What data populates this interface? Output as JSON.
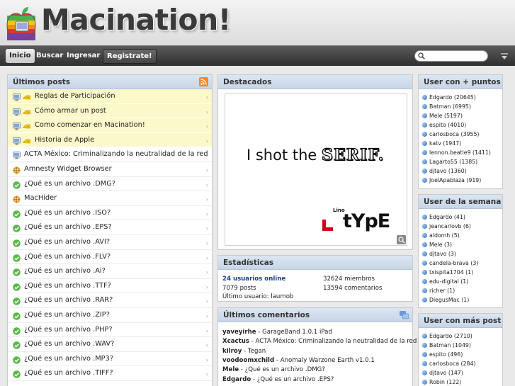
{
  "site": {
    "title": "Macination!"
  },
  "nav": {
    "inicio": "Inicio",
    "buscar": "Buscar",
    "ingresar": "Ingresar",
    "registrate": "Registrate!",
    "search_placeholder": ""
  },
  "posts": {
    "title": "Últimos posts",
    "items": [
      {
        "label": "Reglas de Participación",
        "sticky": true,
        "icon": "mac-icon"
      },
      {
        "label": "Cómo armar un post",
        "sticky": true,
        "icon": "mac-icon"
      },
      {
        "label": "Como comenzar en Macination!",
        "sticky": true,
        "icon": "mac-icon"
      },
      {
        "label": "Historia de Apple",
        "sticky": true,
        "icon": "mac-icon"
      },
      {
        "label": "ACTA México: Criminalizando la neutralidad de la red",
        "sticky": false,
        "icon": "mac-icon"
      },
      {
        "label": "Amnesty Widget Browser",
        "sticky": false,
        "icon": "widget-icon"
      },
      {
        "label": "¿Qué es un archivo .DMG?",
        "sticky": false,
        "icon": "check-icon"
      },
      {
        "label": "MacHider",
        "sticky": false,
        "icon": "widget-icon"
      },
      {
        "label": "¿Qué es un archivo .ISO?",
        "sticky": false,
        "icon": "check-icon"
      },
      {
        "label": "¿Qué es un archivo .EPS?",
        "sticky": false,
        "icon": "check-icon"
      },
      {
        "label": "¿Qué es un archivo .AVI?",
        "sticky": false,
        "icon": "check-icon"
      },
      {
        "label": "¿Qué es un archivo .FLV?",
        "sticky": false,
        "icon": "check-icon"
      },
      {
        "label": "¿Qué es un archivo .Ai?",
        "sticky": false,
        "icon": "check-icon"
      },
      {
        "label": "¿Qué es un archivo .TTF?",
        "sticky": false,
        "icon": "check-icon"
      },
      {
        "label": "¿Qué es un archivo .RAR?",
        "sticky": false,
        "icon": "check-icon"
      },
      {
        "label": "¿Qué es un archivo .ZIP?",
        "sticky": false,
        "icon": "check-icon"
      },
      {
        "label": "¿Qué es un archivo .PHP?",
        "sticky": false,
        "icon": "check-icon"
      },
      {
        "label": "¿Qué es un archivo .WAV?",
        "sticky": false,
        "icon": "check-icon"
      },
      {
        "label": "¿Qué es un archivo .MP3?",
        "sticky": false,
        "icon": "check-icon"
      },
      {
        "label": "¿Qué es un archivo .TIFF?",
        "sticky": false,
        "icon": "check-icon"
      }
    ]
  },
  "destacados": {
    "title": "Destacados",
    "headline_prefix": "I shot the ",
    "headline_emph": "SERIF.",
    "brand_small": "Lino",
    "brand_large": "tYpE"
  },
  "stats": {
    "title": "Estadísticas",
    "online": "24 usuarios online",
    "members": "32624 miembros",
    "posts": "7079 posts",
    "comments": "13594 comentarios",
    "last_user": "Último usuario: laumob"
  },
  "comments": {
    "title": "Últimos comentarios",
    "items": [
      {
        "user": "yaveyirhe",
        "text": " - GarageBand 1.0.1 iPad"
      },
      {
        "user": "Xcactus",
        "text": " - ACTA México: Criminalizando la neutralidad de la red"
      },
      {
        "user": "kilroy",
        "text": " - Tegan"
      },
      {
        "user": "voodoomxchild",
        "text": " - Anomaly Warzone Earth v1.0.1"
      },
      {
        "user": "Mele",
        "text": " - ¿Qué es un archivo .DMG?"
      },
      {
        "user": "Edgardo",
        "text": " - ¿Qué es un archivo .EPS?"
      }
    ]
  },
  "top_users": {
    "title": "User con + puntos",
    "items": [
      "Edgardo (20645)",
      "Batman (6995)",
      "Mele (5197)",
      "espito (4010)",
      "carlosboca (3955)",
      "katv (1947)",
      "lennon.beatle9 (1411)",
      "Lagarto55 (1385)",
      "djtavo (1360)",
      "JoelApablaza (919)"
    ]
  },
  "week_users": {
    "title": "User de la semana",
    "items": [
      "Edgardo (41)",
      "jeancarlovb (6)",
      "aldomh (5)",
      "Mele (3)",
      "djtavo (3)",
      "candela-brava (3)",
      "txispita1704 (1)",
      "edu-digital (1)",
      "richer (1)",
      "DiegusMac (1)"
    ]
  },
  "most_post_users": {
    "title": "User con más post",
    "items": [
      "Edgardo (2710)",
      "Batman (1049)",
      "espito (496)",
      "carlosboca (284)",
      "djtavo (147)",
      "Robin (122)"
    ]
  },
  "colors": {
    "panel_header": "#c7d5e6",
    "sticky_row": "#fbf8c9",
    "link_blue": "#1a3f8f",
    "nav_bar": "#2f2f2f"
  }
}
